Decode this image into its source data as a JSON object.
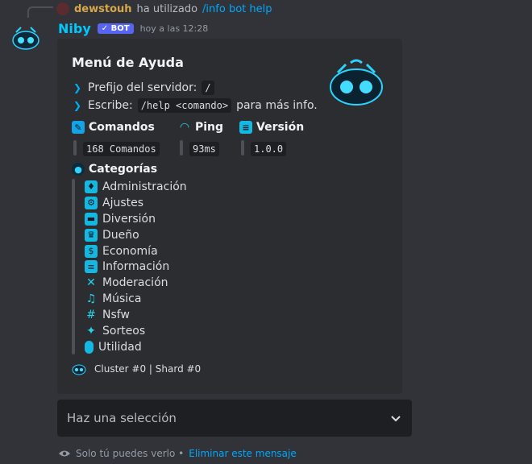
{
  "reply": {
    "user": "dewstouh",
    "used_text": "ha utilizado",
    "command": "/info bot help"
  },
  "message": {
    "bot_name": "Niby",
    "bot_tag": "✓ BOT",
    "timestamp": "hoy a las 12:28"
  },
  "embed": {
    "title": "Menú de Ayuda",
    "prefix_label": "Prefijo del servidor:",
    "prefix_value": "/",
    "write_label": "Escribe:",
    "write_code": "/help <comando>",
    "write_suffix": "para más info.",
    "fields": [
      {
        "title": "Comandos",
        "value": "168 Comandos",
        "icon": "pencil-icon"
      },
      {
        "title": "Ping",
        "value": "93ms",
        "icon": "wifi-icon"
      },
      {
        "title": "Versión",
        "value": "1.0.0",
        "icon": "document-icon"
      }
    ],
    "categories_title": "Categorías",
    "categories": [
      {
        "label": "Administración",
        "icon": "shield-icon"
      },
      {
        "label": "Ajustes",
        "icon": "gear-icon"
      },
      {
        "label": "Diversión",
        "icon": "gamepad-icon"
      },
      {
        "label": "Dueño",
        "icon": "crown-icon"
      },
      {
        "label": "Economía",
        "icon": "money-icon"
      },
      {
        "label": "Información",
        "icon": "info-icon"
      },
      {
        "label": "Moderación",
        "icon": "hammer-icon"
      },
      {
        "label": "Música",
        "icon": "music-icon"
      },
      {
        "label": "Nsfw",
        "icon": "hashtag-icon"
      },
      {
        "label": "Sorteos",
        "icon": "party-icon"
      },
      {
        "label": "Utilidad",
        "icon": "mouse-icon"
      }
    ],
    "footer": "Cluster #0 | Shard #0"
  },
  "select": {
    "placeholder": "Haz una selección"
  },
  "ephemeral": {
    "notice": "Solo tú puedes verlo •",
    "dismiss": "Eliminar este mensaje"
  },
  "colors": {
    "accent": "#00c8ff",
    "bot_tag": "#5865f2",
    "link": "#00a8fc"
  }
}
